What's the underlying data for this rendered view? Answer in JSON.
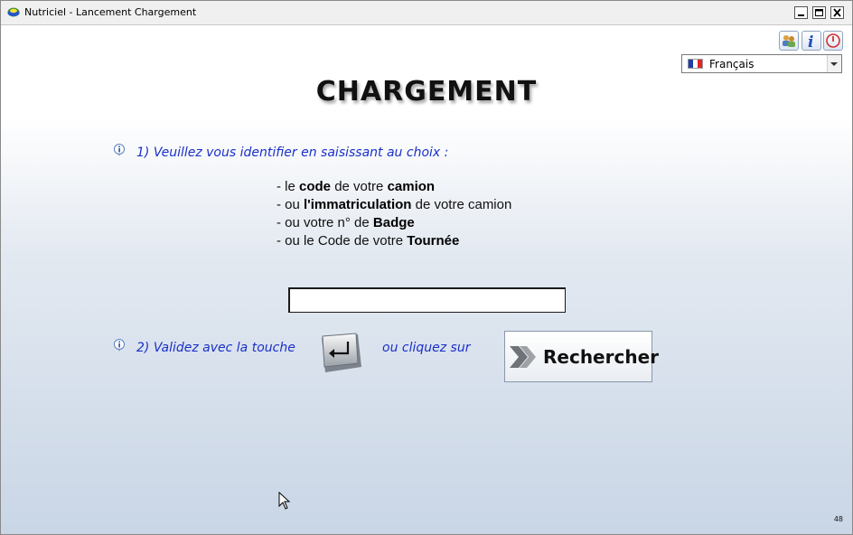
{
  "window": {
    "title": "Nutriciel - Lancement Chargement",
    "app_icon": "nutriciel-logo-icon",
    "controls": [
      "minimize-icon",
      "maximize-icon",
      "close-icon"
    ]
  },
  "toolbar": {
    "icons": [
      "users-icon",
      "info-icon",
      "power-icon"
    ],
    "language": {
      "selected": "Français",
      "flag": "france-flag-icon"
    }
  },
  "page": {
    "heading": "CHARGEMENT",
    "step1": "1) Veuillez vous identifier en saisissant au choix :",
    "options": [
      {
        "prefix": "- le ",
        "b1": "code",
        "middle": " de votre ",
        "b2": "camion"
      },
      {
        "prefix": "- ou ",
        "b1": "l'immatriculation",
        "middle": " de votre camion",
        "b2": ""
      },
      {
        "prefix": "- ou votre n° de ",
        "b1": "Badge",
        "middle": "",
        "b2": ""
      },
      {
        "prefix": "- ou le Code de votre ",
        "b1": "Tournée",
        "middle": "",
        "b2": ""
      }
    ],
    "input": {
      "value": "",
      "placeholder": ""
    },
    "step2_left": "2) Validez avec la touche",
    "step2_right": "ou cliquez sur",
    "search_button": "Rechercher",
    "build_number": "48"
  },
  "colors": {
    "step_text": "#1a30c8",
    "gradient_bottom": "#c9d6e6",
    "flag": [
      "#1f3ea8",
      "#ffffff",
      "#e0262a"
    ]
  }
}
